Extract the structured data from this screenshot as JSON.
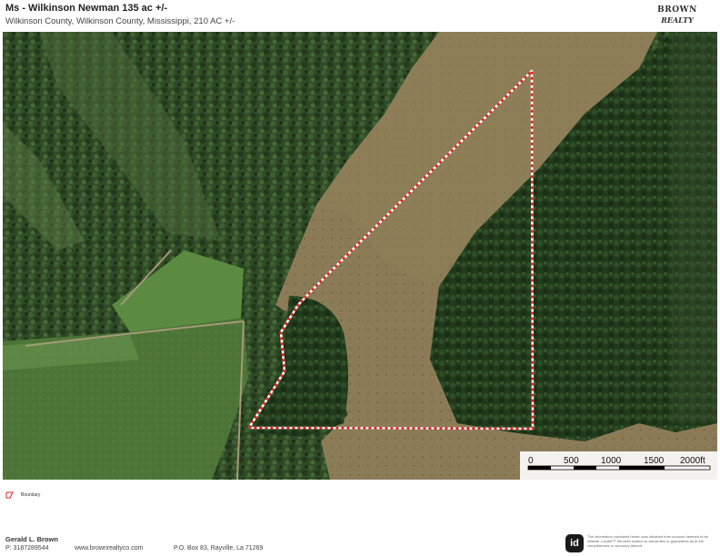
{
  "header": {
    "title": "Ms - Wilkinson Newman 135 ac +/-",
    "subtitle": "Wilkinson County, Wilkinson County, Mississippi, 210 AC +/-"
  },
  "logo": {
    "line1": "BROWN",
    "line2": "REALTY"
  },
  "map": {
    "scale_labels": [
      "0",
      "500",
      "1000",
      "1500",
      "2000ft"
    ],
    "boundary_color": "#e02020"
  },
  "legend": {
    "boundary_label": "Boundary"
  },
  "footer": {
    "name": "Gerald L. Brown",
    "phone": "P: 3187289544",
    "website": "www.brownrealtyco.com",
    "address": "P.O. Box 83, Rayville, La 71269",
    "badge": "id",
    "disclaimer": "The information contained herein was obtained from sources deemed to be reliable. LandId™ Services makes no warranties or guarantees as to the completeness or accuracy thereof."
  }
}
